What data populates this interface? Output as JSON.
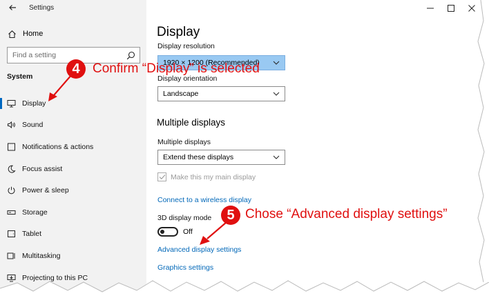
{
  "app": {
    "title": "Settings"
  },
  "sidebar": {
    "home_label": "Home",
    "search_placeholder": "Find a setting",
    "section_label": "System",
    "items": [
      {
        "label": "Display",
        "icon": "monitor-icon",
        "active": true
      },
      {
        "label": "Sound",
        "icon": "speaker-icon"
      },
      {
        "label": "Notifications & actions",
        "icon": "notification-icon"
      },
      {
        "label": "Focus assist",
        "icon": "moon-icon"
      },
      {
        "label": "Power & sleep",
        "icon": "power-icon"
      },
      {
        "label": "Storage",
        "icon": "storage-icon"
      },
      {
        "label": "Tablet",
        "icon": "tablet-icon"
      },
      {
        "label": "Multitasking",
        "icon": "multitasking-icon"
      },
      {
        "label": "Projecting to this PC",
        "icon": "projecting-icon"
      }
    ]
  },
  "main": {
    "title": "Display",
    "resolution": {
      "label": "Display resolution",
      "value": "1920 × 1200 (Recommended)"
    },
    "orientation": {
      "label": "Display orientation",
      "value": "Landscape"
    },
    "multiple_heading": "Multiple displays",
    "multiple": {
      "label": "Multiple displays",
      "value": "Extend these displays"
    },
    "main_display_checkbox": "Make this my main display",
    "wireless_link": "Connect to a wireless display",
    "mode_3d": {
      "label": "3D display mode",
      "state": "Off"
    },
    "advanced_link": "Advanced display settings",
    "graphics_link": "Graphics settings"
  },
  "annotations": [
    {
      "number": "4",
      "text": "Confirm “Display” is selected"
    },
    {
      "number": "5",
      "text": "Chose “Advanced display settings”"
    }
  ],
  "colors": {
    "accent": "#0067c0",
    "link": "#0067b8",
    "annotation": "#e01010",
    "sidebar_bg": "#f2f2f2"
  }
}
